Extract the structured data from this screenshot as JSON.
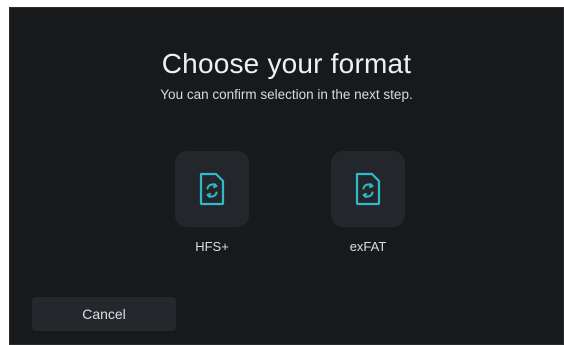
{
  "dialog": {
    "title": "Choose your format",
    "subtitle": "You can confirm selection in the next step."
  },
  "formats": [
    {
      "label": "HFS+",
      "icon": "format-file-icon"
    },
    {
      "label": "exFAT",
      "icon": "format-file-icon"
    }
  ],
  "actions": {
    "cancel_label": "Cancel"
  },
  "colors": {
    "background": "#17191b",
    "tile": "#23272b",
    "icon_accent": "#2fb9c9",
    "text": "#eef0f2"
  }
}
